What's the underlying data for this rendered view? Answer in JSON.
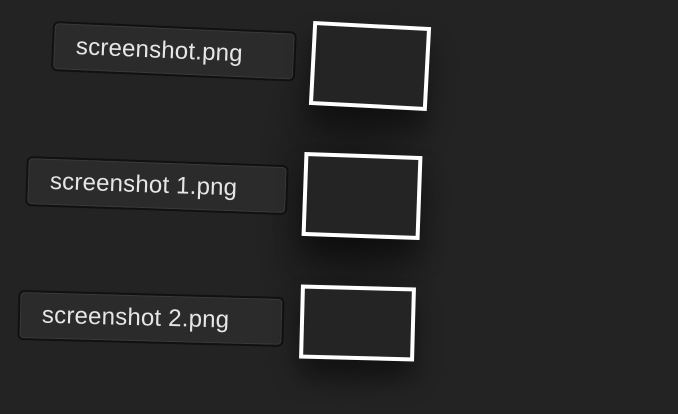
{
  "desktop": {
    "files": [
      {
        "name": "screenshot.png"
      },
      {
        "name": "screenshot 1.png"
      },
      {
        "name": "screenshot 2.png"
      }
    ]
  }
}
